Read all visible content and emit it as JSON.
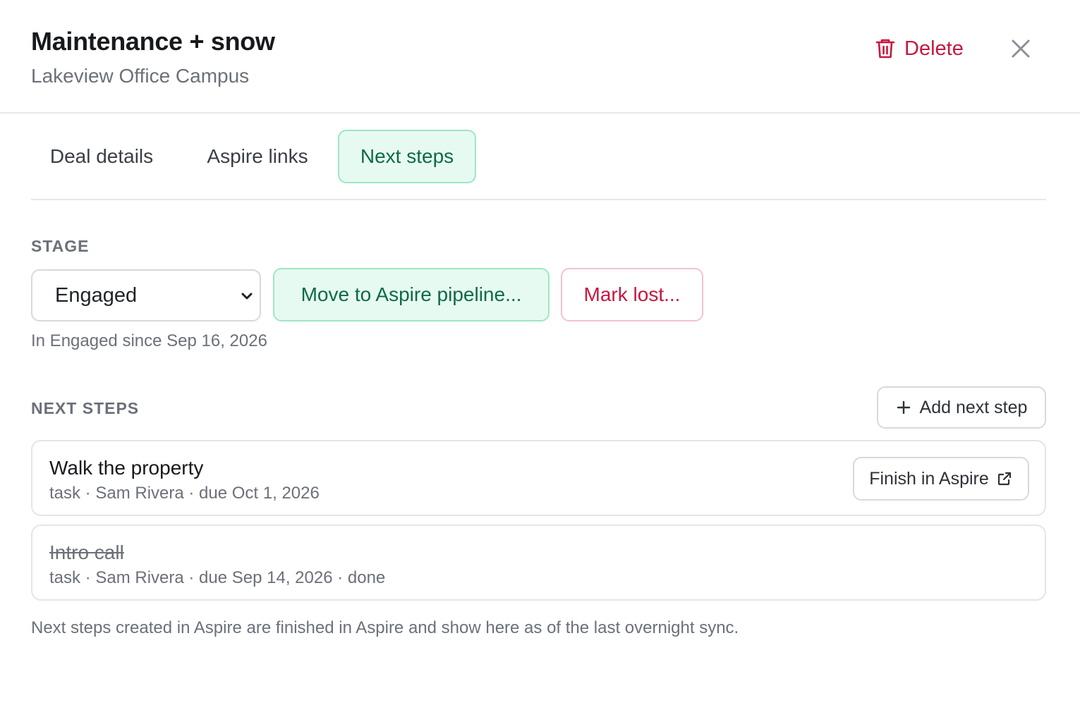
{
  "header": {
    "title": "Maintenance + snow",
    "subtitle": "Lakeview Office Campus",
    "delete_label": "Delete"
  },
  "tabs": [
    {
      "label": "Deal details",
      "active": false
    },
    {
      "label": "Aspire links",
      "active": false
    },
    {
      "label": "Next steps",
      "active": true
    }
  ],
  "stage": {
    "section_label": "STAGE",
    "selected": "Engaged",
    "move_label": "Move to Aspire pipeline...",
    "lost_label": "Mark lost...",
    "since_text": "In Engaged since Sep 16, 2026"
  },
  "next_steps": {
    "section_label": "NEXT STEPS",
    "add_label": "Add next step",
    "items": [
      {
        "title": "Walk the property",
        "meta": "task · Sam Rivera · due Oct 1, 2026",
        "action_label": "Finish in Aspire",
        "done": false
      },
      {
        "title": "Intro call",
        "meta": "task · Sam Rivera · due Sep 14, 2026 · done",
        "done": true
      }
    ],
    "footnote": "Next steps created in Aspire are finished in Aspire and show here as of the last overnight sync."
  },
  "colors": {
    "accent_green": "#0c6b45",
    "accent_green_bg": "#e7faf1",
    "danger": "#c8163f"
  },
  "icons": [
    "trash-icon",
    "close-icon",
    "chevron-down-icon",
    "plus-icon",
    "external-link-icon"
  ]
}
